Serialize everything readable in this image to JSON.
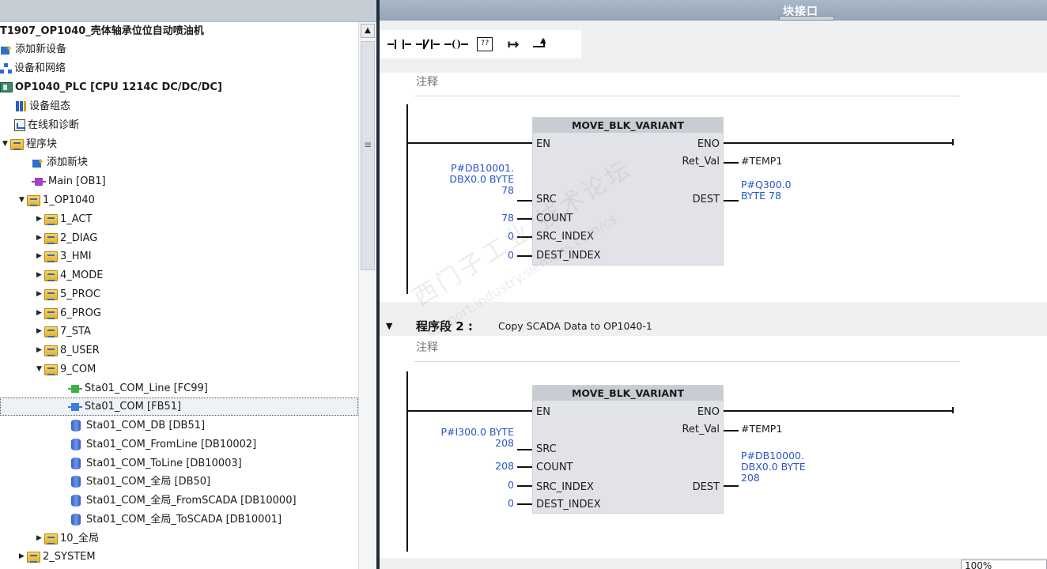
{
  "tree": {
    "items": [
      {
        "label": "T1907_OP1040_壳体轴承位位自动喷油机",
        "icon": "",
        "arrow": ""
      },
      {
        "label": "添加新设备",
        "icon": "add-device-icon",
        "arrow": ""
      },
      {
        "label": "设备和网络",
        "icon": "network-icon",
        "arrow": ""
      },
      {
        "label": "OP1040_PLC [CPU 1214C DC/DC/DC]",
        "icon": "plc-icon",
        "arrow": ""
      },
      {
        "label": "设备组态",
        "icon": "device-config-icon",
        "arrow": ""
      },
      {
        "label": "在线和诊断",
        "icon": "diagnostics-icon",
        "arrow": ""
      },
      {
        "label": "程序块",
        "icon": "folder-icon",
        "arrow": "▼"
      },
      {
        "label": "添加新块",
        "icon": "add-block-icon",
        "arrow": ""
      },
      {
        "label": "Main [OB1]",
        "icon": "ob-icon",
        "arrow": ""
      },
      {
        "label": "1_OP1040",
        "icon": "folder-icon",
        "arrow": "▼"
      },
      {
        "label": "1_ACT",
        "icon": "folder-icon",
        "arrow": "▶"
      },
      {
        "label": "2_DIAG",
        "icon": "folder-icon",
        "arrow": "▶"
      },
      {
        "label": "3_HMI",
        "icon": "folder-icon",
        "arrow": "▶"
      },
      {
        "label": "4_MODE",
        "icon": "folder-icon",
        "arrow": "▶"
      },
      {
        "label": "5_PROC",
        "icon": "folder-icon",
        "arrow": "▶"
      },
      {
        "label": "6_PROG",
        "icon": "folder-icon",
        "arrow": "▶"
      },
      {
        "label": "7_STA",
        "icon": "folder-icon",
        "arrow": "▶"
      },
      {
        "label": "8_USER",
        "icon": "folder-icon",
        "arrow": "▶"
      },
      {
        "label": "9_COM",
        "icon": "folder-icon",
        "arrow": "▼"
      },
      {
        "label": "Sta01_COM_Line [FC99]",
        "icon": "fc-icon",
        "arrow": ""
      },
      {
        "label": "Sta01_COM [FB51]",
        "icon": "fb-icon",
        "arrow": ""
      },
      {
        "label": "Sta01_COM_DB [DB51]",
        "icon": "db-icon",
        "arrow": ""
      },
      {
        "label": "Sta01_COM_FromLine [DB10002]",
        "icon": "db-icon",
        "arrow": ""
      },
      {
        "label": "Sta01_COM_ToLine [DB10003]",
        "icon": "db-icon",
        "arrow": ""
      },
      {
        "label": "Sta01_COM_全局 [DB50]",
        "icon": "db-icon",
        "arrow": ""
      },
      {
        "label": "Sta01_COM_全局_FromSCADA [DB10000]",
        "icon": "db-icon",
        "arrow": ""
      },
      {
        "label": "Sta01_COM_全局_ToSCADA [DB10001]",
        "icon": "db-icon",
        "arrow": ""
      },
      {
        "label": "10_全局",
        "icon": "folder-icon",
        "arrow": "▶"
      },
      {
        "label": "2_SYSTEM",
        "icon": "folder-icon",
        "arrow": "▶"
      }
    ]
  },
  "editor": {
    "header_title": "块接口",
    "toolbar": {
      "buttons": [
        {
          "name": "no-contact-button",
          "icon": "normally-open-contact-icon"
        },
        {
          "name": "nc-contact-button",
          "icon": "normally-closed-contact-icon"
        },
        {
          "name": "coil-button",
          "icon": "coil-icon"
        },
        {
          "name": "empty-box-button",
          "icon": "empty-box-icon",
          "text": "??"
        },
        {
          "name": "open-branch-button",
          "icon": "open-branch-icon"
        },
        {
          "name": "close-branch-button",
          "icon": "close-branch-icon"
        }
      ]
    },
    "network1": {
      "comment": "注释",
      "block": {
        "title": "MOVE_BLK_VARIANT",
        "pins_in": [
          "EN",
          "SRC",
          "COUNT",
          "SRC_INDEX",
          "DEST_INDEX"
        ],
        "pins_out": [
          "ENO",
          "Ret_Val",
          "DEST"
        ],
        "src_operand": [
          "P#DB10001.",
          "DBX0.0 BYTE",
          "78"
        ],
        "count_value": "78",
        "src_index_value": "0",
        "dest_index_value": "0",
        "ret_val_operand": "#TEMP1",
        "dest_operand": [
          "P#Q300.0",
          "BYTE 78"
        ]
      }
    },
    "network2": {
      "title": "程序段 2 :",
      "subtitle": "Copy SCADA Data  to OP1040-1",
      "comment": "注释",
      "block": {
        "title": "MOVE_BLK_VARIANT",
        "pins_in": [
          "EN",
          "SRC",
          "COUNT",
          "SRC_INDEX",
          "DEST_INDEX"
        ],
        "pins_out": [
          "ENO",
          "Ret_Val",
          "DEST"
        ],
        "src_operand": [
          "P#I300.0 BYTE",
          "208"
        ],
        "count_value": "208",
        "src_index_value": "0",
        "dest_index_value": "0",
        "ret_val_operand": "#TEMP1",
        "dest_operand": [
          "P#DB10000.",
          "DBX0.0 BYTE",
          "208"
        ]
      }
    },
    "zoom": "100%",
    "watermark": [
      "西门子工业 技术论坛",
      "support.industry.siemens.com/cs"
    ]
  },
  "colors": {
    "operand_blue": "#2a56c6",
    "block_fill": "#e1e3e8",
    "header_blue": "#9fb0c2",
    "splitter": "#232c3b"
  }
}
